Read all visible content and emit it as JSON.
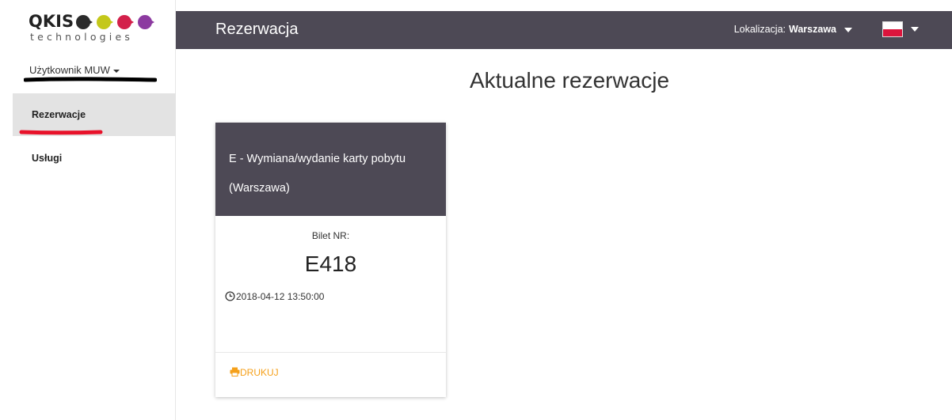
{
  "logo": {
    "word": "QKIS",
    "subtitle": "technologies"
  },
  "sidebar": {
    "user_label": "Użytkownik MUW",
    "items": [
      {
        "label": "Rezerwacje",
        "active": true
      },
      {
        "label": "Usługi",
        "active": false
      }
    ]
  },
  "header": {
    "title": "Rezerwacja",
    "location_label": "Lokalizacja:",
    "location_value": "Warszawa",
    "language_flag": "flag-pl-icon"
  },
  "main": {
    "heading": "Aktualne rezerwacje",
    "card": {
      "service_line1": "E - Wymiana/wydanie karty pobytu",
      "service_line2": "(Warszawa)",
      "ticket_label": "Bilet NR:",
      "ticket_number": "E418",
      "datetime": "2018-04-12 13:50:00",
      "print_label": "DRUKUJ"
    }
  },
  "colors": {
    "header_bg": "#4d4955",
    "accent_print": "#f5a01a",
    "active_item_bg": "#e3e3e3"
  }
}
